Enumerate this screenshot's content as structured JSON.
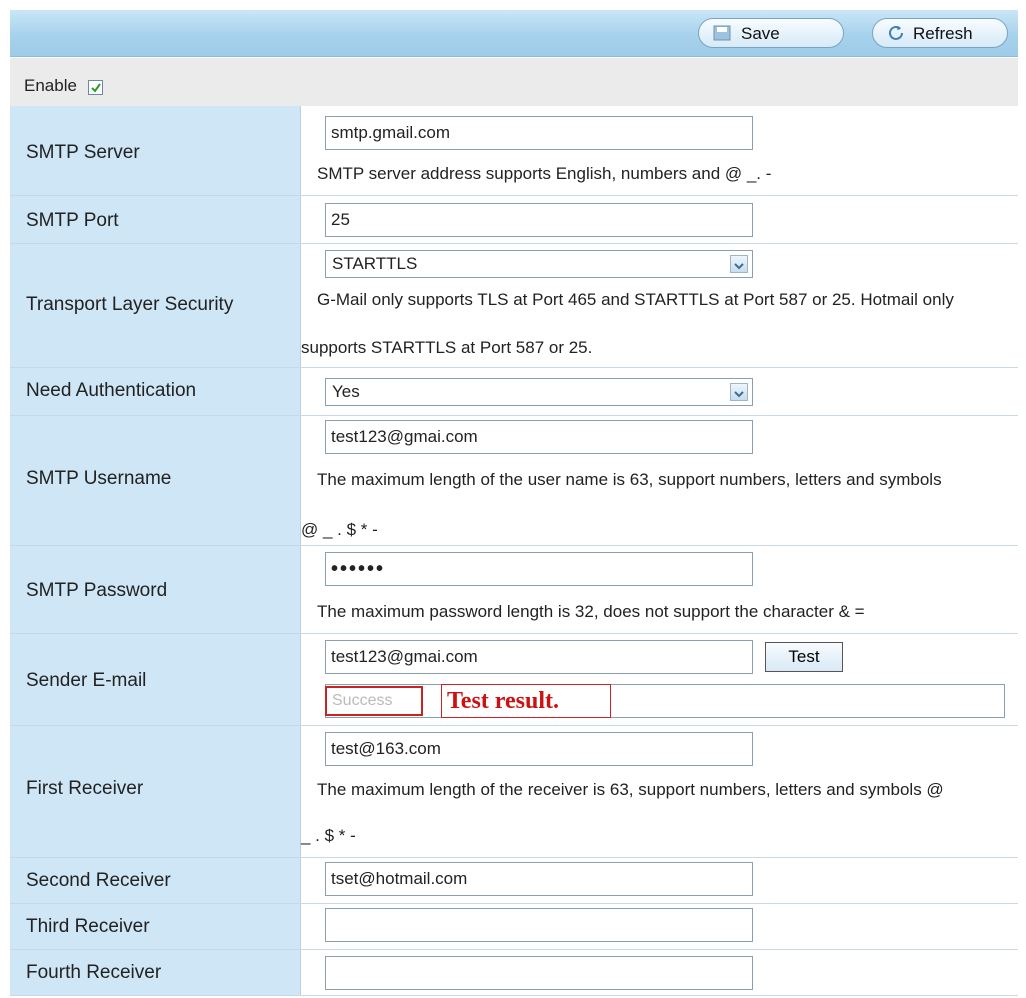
{
  "toolbar": {
    "save_label": "Save",
    "refresh_label": "Refresh"
  },
  "enable": {
    "label": "Enable",
    "checked": true
  },
  "rows": [
    {
      "label": "SMTP Server",
      "value": "smtp.gmail.com",
      "hint": "SMTP server address supports English, numbers and @ _. -"
    },
    {
      "label": "SMTP Port",
      "value": "25"
    },
    {
      "label": "Transport Layer Security",
      "value": "STARTTLS",
      "hint_line1": "G-Mail only supports TLS at Port 465 and STARTTLS at Port 587 or 25. Hotmail only",
      "hint_line2": "supports STARTTLS at Port 587 or 25."
    },
    {
      "label": "Need Authentication",
      "value": "Yes"
    },
    {
      "label": "SMTP Username",
      "value": "test123@gmai.com",
      "hint_line1": "The maximum length of the user name is 63, support numbers, letters and symbols",
      "hint_line2": "@ _ . $ * -"
    },
    {
      "label": "SMTP Password",
      "value": "••••••",
      "hint": "The maximum password length is 32, does not support the character & ="
    },
    {
      "label": "Sender E-mail",
      "value": "test123@gmai.com",
      "test_label": "Test",
      "status": "Success",
      "annotation": "Test result."
    },
    {
      "label": "First Receiver",
      "value": "test@163.com",
      "hint_line1": "The maximum length of the receiver is 63, support numbers, letters and symbols @",
      "hint_line2": "_ . $ * -"
    },
    {
      "label": "Second Receiver",
      "value": "tset@hotmail.com"
    },
    {
      "label": "Third Receiver",
      "value": ""
    },
    {
      "label": "Fourth Receiver",
      "value": ""
    }
  ]
}
